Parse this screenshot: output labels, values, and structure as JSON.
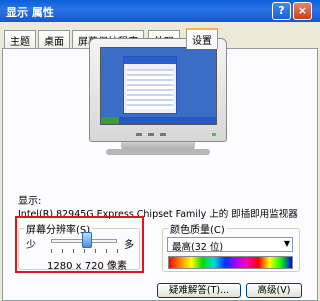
{
  "window": {
    "title": "显示 属性",
    "help_label": "?",
    "close_label": "×"
  },
  "tabs": [
    {
      "label": "主题"
    },
    {
      "label": "桌面"
    },
    {
      "label": "屏幕保护程序"
    },
    {
      "label": "外观"
    },
    {
      "label": "设置",
      "active": true
    }
  ],
  "display": {
    "label": "显示:",
    "device": "Intel(R) 82945G Express Chipset Family 上的 即插即用监视器"
  },
  "resolution": {
    "title": "屏幕分辨率(S)",
    "min_label": "少",
    "max_label": "多",
    "value": "1280 x 720 像素",
    "slider_level": 0.55
  },
  "color": {
    "title": "颜色质量(C)",
    "selected": "最高(32 位)"
  },
  "buttons": {
    "troubleshoot": "疑难解答(T)...",
    "advanced": "高级(V)"
  },
  "accent": {
    "highlight": "#e8101a",
    "titlebar": "#0a5fd8"
  }
}
